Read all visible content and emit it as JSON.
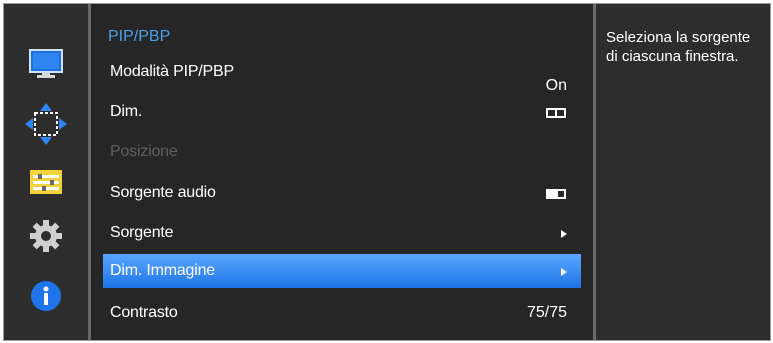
{
  "sidebar": {
    "items": [
      {
        "icon": "monitor-icon"
      },
      {
        "icon": "pip-arrows-icon"
      },
      {
        "icon": "system-settings-icon"
      },
      {
        "icon": "gear-icon"
      },
      {
        "icon": "info-icon"
      }
    ]
  },
  "menu": {
    "title": "PIP/PBP",
    "rows": [
      {
        "label": "Modalità PIP/PBP",
        "value": "On"
      },
      {
        "label": "Dim.",
        "value_icon": "pbp-split-icon"
      },
      {
        "label": "Posizione",
        "disabled": true
      },
      {
        "label": "Sorgente audio",
        "value_icon": "audio-source-icon"
      },
      {
        "label": "Sorgente",
        "value_icon": "arrow-right-icon"
      },
      {
        "label": "Dim. Immagine",
        "value_icon": "arrow-right-icon",
        "selected": true
      },
      {
        "label": "Contrasto",
        "value": "75/75"
      }
    ]
  },
  "description": {
    "text": "Seleziona la sorgente di ciascuna finestra."
  },
  "colors": {
    "title": "#4aa0ec",
    "selected_row": "#2f86f2",
    "background": "#2d2d2d"
  }
}
